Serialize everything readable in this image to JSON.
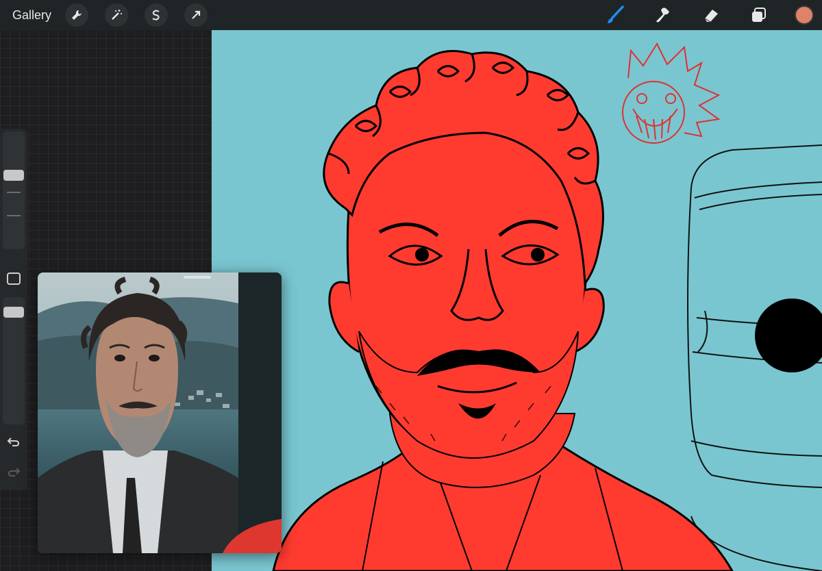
{
  "topbar": {
    "gallery_label": "Gallery",
    "left_tools": [
      {
        "icon": "wrench-icon",
        "name": "actions"
      },
      {
        "icon": "magic-wand-icon",
        "name": "adjustments"
      },
      {
        "icon": "selection-icon",
        "name": "selection"
      },
      {
        "icon": "arrow-cursor-icon",
        "name": "transform"
      }
    ],
    "right_tools": [
      {
        "icon": "brush-icon",
        "name": "brush",
        "active": true
      },
      {
        "icon": "smudge-icon",
        "name": "smudge"
      },
      {
        "icon": "eraser-icon",
        "name": "eraser"
      },
      {
        "icon": "layers-icon",
        "name": "layers"
      }
    ],
    "current_color": "#e0826a",
    "active_tool_color": "#1f8cf0"
  },
  "sidebar": {
    "size_slider_level": 0.35,
    "opacity_slider_level": 0.05,
    "undo_icon": "undo-icon",
    "redo_icon": "redo-icon"
  },
  "canvas": {
    "background_color": "#79c6d0",
    "figure_fill": "#ff3b30",
    "line_color": "#000000",
    "sketch_color": "#e13030"
  },
  "reference": {
    "title_hidden": true
  }
}
